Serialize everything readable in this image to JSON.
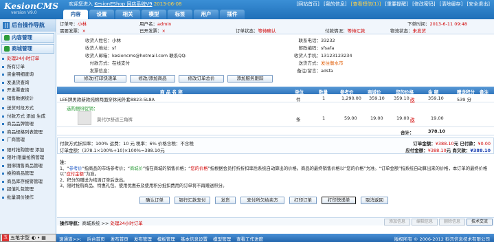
{
  "header": {
    "brand": "KesionCMS",
    "version": "version V9.0",
    "welcome": "欢迎您进入",
    "site_link": "KesionEShop 网店系统V9",
    "date": "2013-06-08",
    "links": [
      "[网站首页]",
      "[我的信息]",
      "[查看短信(1)]",
      "[重要提醒]",
      "[修改密码]",
      "[清除缓存]",
      "[安全退出]"
    ]
  },
  "tabs": [
    {
      "label": "内容",
      "active": true
    },
    {
      "label": "设置"
    },
    {
      "label": "相关"
    },
    {
      "label": "模型"
    },
    {
      "label": "标签"
    },
    {
      "label": "用户"
    },
    {
      "label": "插件"
    }
  ],
  "sidebar": {
    "title": "后台操作导航",
    "sections": [
      {
        "label": "内容管理",
        "items": []
      },
      {
        "label": "商城管理",
        "items": [
          {
            "label": "处理24小时订单",
            "red": true
          },
          {
            "label": "所有订单"
          },
          {
            "label": "资金明细查询"
          },
          {
            "label": "发退货查询"
          },
          {
            "label": "开发票查询"
          },
          {
            "label": "销售数据统计"
          },
          {
            "label": "送货时段方式",
            "gap": true
          },
          {
            "label": "付款方式 添加 生成"
          },
          {
            "label": "商品品牌管理"
          },
          {
            "label": "商品规格列表管理"
          },
          {
            "label": "厂商管理"
          },
          {
            "label": "限时抢购管理 添加",
            "gap": true
          },
          {
            "label": "限时/限量抢购管理"
          },
          {
            "label": "捆绑销售商品管理"
          },
          {
            "label": "换购商品管理"
          },
          {
            "label": "商品库存报警管理"
          },
          {
            "label": "超值礼包管理"
          },
          {
            "label": "批量调价操作"
          }
        ]
      }
    ]
  },
  "summary": {
    "order_no_label": "订单号：",
    "order_no": "小林",
    "buyer_label": "用户名：",
    "buyer": "admin",
    "order_time_label": "下单时间：",
    "order_time": "2013-6-11 09:48",
    "need_invoice_label": "需要发票：",
    "need_invoice": "×",
    "invoiced_label": "已开发票：",
    "invoiced": "×",
    "order_status_label": "订单状态：",
    "order_status": "等待确认",
    "pay_status_label": "付款情况：",
    "pay_status": "等待汇款",
    "ship_status_label": "物流状态：",
    "ship_status": "未发货"
  },
  "info": {
    "name_label": "收货人姓名：",
    "name": "小林",
    "addr_label": "收货人地址：",
    "addr": "sf",
    "email_label": "收货人邮箱：",
    "email": "kesioncms@hotmail.com 联系QQ:",
    "pay_method_label": "付款方式：",
    "pay_method": "在线支付",
    "invoice_info_label": "发票信息：",
    "invoice_info": "",
    "phone_label": "联系电话：",
    "phone": "33232",
    "zip_label": "邮政编码：",
    "zip": "sfsafa",
    "mobile_label": "收货人手机：",
    "mobile": "13123123234",
    "ship_method_label": "送货方式：",
    "ship_method": "发往衡水市",
    "remark_label": "备注/留言：",
    "remark": "adsfa"
  },
  "action_buttons_1": [
    "修改/打印快递单",
    "修改/添加商品",
    "修改订单总价",
    "添加服务跟踪"
  ],
  "goods": {
    "headers": [
      "商 品 名 称",
      "单位",
      "数量",
      "参考价",
      "商城价",
      "您的价格",
      "金 额",
      "赠送积分",
      "备注"
    ],
    "rows": [
      {
        "name": "LEE牌男款新款纯棉两面穿休闲外套8823-5L8A",
        "unit": "件",
        "qty": "1",
        "ref": "1,290.00",
        "mall": "359.10",
        "yours": "359.10",
        "change": "改",
        "amount": "359.10",
        "points": "539 分",
        "note": ""
      },
      {
        "tag": "选购捆绑促销：",
        "name": "莫代尔舒适三角裤",
        "unit": "条",
        "qty": "1",
        "ref": "59.00",
        "mall": "19.00",
        "yours": "19.00",
        "change": "改",
        "amount": "19.00",
        "points": "",
        "note": ""
      }
    ],
    "total_label": "合计：",
    "total": "378.10"
  },
  "payment": {
    "line1": "付款方式折扣率：100%    运费：10 元    税率：6%    价格含税：不含税",
    "line2": "订单金额：(378.1×100%+10)×100%=388.10元",
    "order_amount_label": "订单金额：",
    "order_amount": "¥388.10",
    "received_label": "元  已付款：",
    "received": "¥0.00",
    "payable_label": "应付金额：",
    "payable": "¥388.10",
    "owed_label": "元  尚欠款：",
    "owed": "¥388.10"
  },
  "notes": {
    "title": "注：",
    "n1_a": "1、“",
    "n1_ref": "参考价",
    "n1_b": "”指商品的市场参考价；“",
    "n1_mall": "商城价",
    "n1_c": "”指在商城的销售价格；“",
    "n1_yours": "您的价格",
    "n1_d": "”指根据会员打折折扣率后系统自动算出的价格。商品的最终销售价格以“您的价格”为准。“订单金额”指系统自动算出来的价格，本订单的最终价格以“",
    "n1_final": "应付金额",
    "n1_e": "”为准。",
    "n2": "2、积分的赠送为结清订单后送出。",
    "n3": "3、限时抢购商品、特惠礼包、使用优惠券及使用积分抵扣费用的订单将不再赠送积分。"
  },
  "action_buttons_2": [
    {
      "label": "确认订单"
    },
    {
      "label": "银行汇款支付"
    },
    {
      "label": "发货"
    },
    {
      "label": "支付所欠给卖方"
    },
    {
      "label": "打印订单"
    },
    {
      "label": "打印快递单",
      "selected": true
    },
    {
      "label": "取消返回"
    }
  ],
  "op": {
    "label": "操作导航：",
    "path_a": "商城系统 >> ",
    "path_b": "处理24小时订单",
    "buttons": [
      {
        "label": "添加信息"
      },
      {
        "label": "编辑信息"
      },
      {
        "label": "删除信息"
      },
      {
        "label": "技术交流",
        "active": true
      }
    ]
  },
  "bottom": {
    "ime": "五笔字型",
    "links": [
      "速通道>>:",
      "后台首页",
      "发布首页",
      "发布管理",
      "模板管理",
      "基本信息设置",
      "模型管理",
      "查看工作进度"
    ],
    "copyright": "版权所有 © 2006-2012 科汛信息技术有限公司"
  }
}
